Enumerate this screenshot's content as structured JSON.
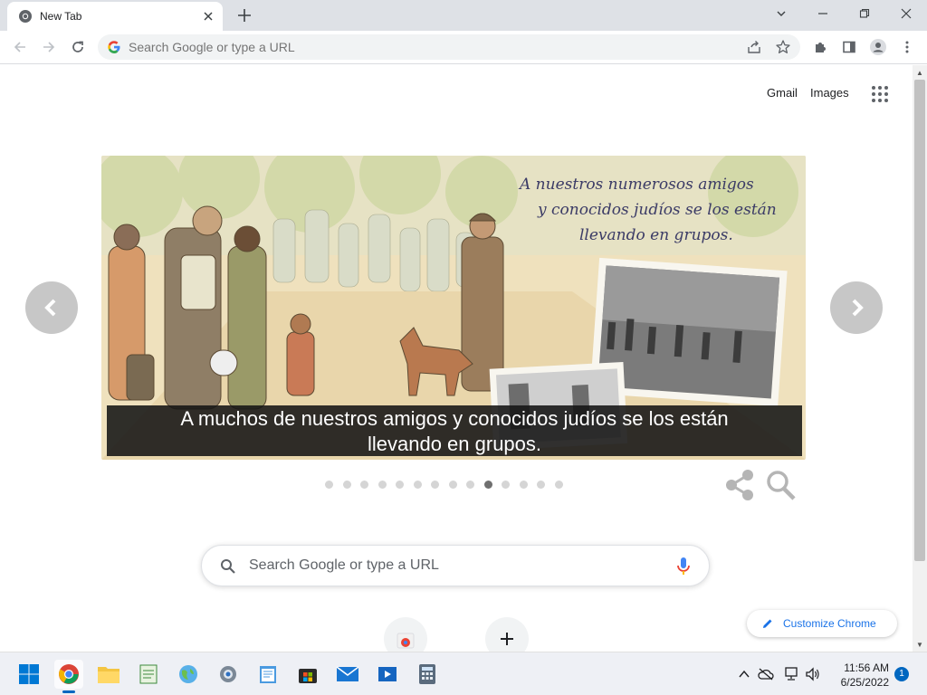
{
  "browser": {
    "tab_title": "New Tab",
    "omnibox_placeholder": "Search Google or type a URL",
    "accent": "#1a73e8"
  },
  "header": {
    "gmail_label": "Gmail",
    "images_label": "Images"
  },
  "doodle": {
    "handwritten_lines": [
      "A nuestros numerosos amigos",
      "y conocidos judíos se los están",
      "llevando en grupos."
    ],
    "caption_lines": [
      "A muchos de nuestros amigos y conocidos judíos se los están",
      "llevando en grupos."
    ],
    "slide_count": 14,
    "active_slide": 10
  },
  "search": {
    "placeholder": "Search Google or type a URL"
  },
  "customize": {
    "label": "Customize Chrome"
  },
  "taskbar": {
    "apps": [
      "start",
      "chrome",
      "file-explorer",
      "notepad-sheet",
      "globe-app",
      "settings",
      "notepad",
      "store",
      "mail",
      "media-player",
      "calculator"
    ],
    "time": "11:56 AM",
    "date": "6/25/2022",
    "notification_count": "1"
  }
}
